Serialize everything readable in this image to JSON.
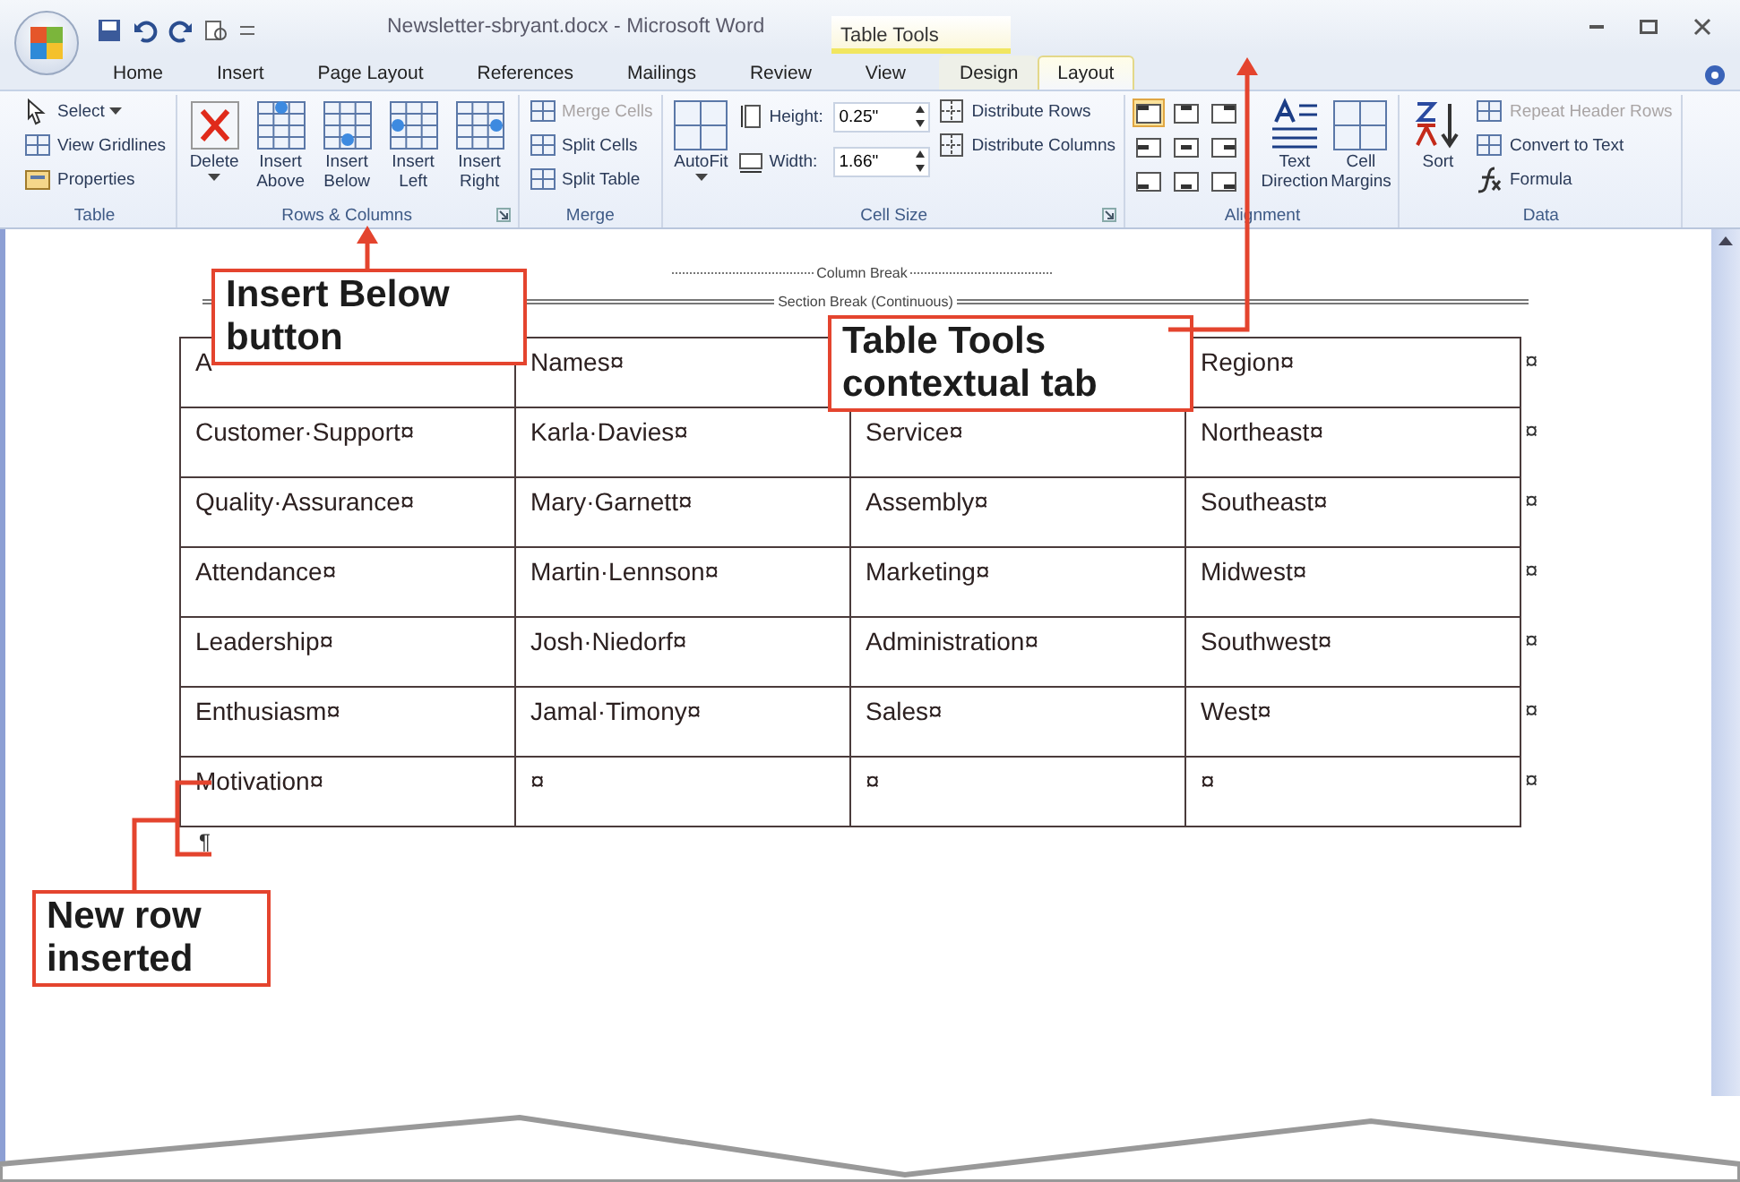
{
  "window": {
    "title": "Newsletter-sbryant.docx - Microsoft Word",
    "context_tab_label": "Table Tools"
  },
  "tabs": [
    {
      "label": "Home",
      "selected": false,
      "contextual": false
    },
    {
      "label": "Insert",
      "selected": false,
      "contextual": false
    },
    {
      "label": "Page Layout",
      "selected": false,
      "contextual": false
    },
    {
      "label": "References",
      "selected": false,
      "contextual": false
    },
    {
      "label": "Mailings",
      "selected": false,
      "contextual": false
    },
    {
      "label": "Review",
      "selected": false,
      "contextual": false
    },
    {
      "label": "View",
      "selected": false,
      "contextual": false
    },
    {
      "label": "Design",
      "selected": false,
      "contextual": true
    },
    {
      "label": "Layout",
      "selected": true,
      "contextual": true
    }
  ],
  "ribbon": [
    {
      "label": "Table",
      "launcher": false,
      "items": [
        {
          "kind": "small",
          "label": "Select",
          "dropdown": true,
          "disabled": false
        },
        {
          "kind": "small",
          "label": "View Gridlines",
          "dropdown": false,
          "disabled": false
        },
        {
          "kind": "small",
          "label": "Properties",
          "dropdown": false,
          "disabled": false
        }
      ]
    },
    {
      "label": "Rows & Columns",
      "launcher": true,
      "items": [
        {
          "kind": "large",
          "label": "Delete",
          "dropdown": true,
          "disabled": false
        },
        {
          "kind": "large",
          "label": "Insert Above",
          "dropdown": false,
          "disabled": false
        },
        {
          "kind": "large",
          "label": "Insert Below",
          "dropdown": false,
          "disabled": false
        },
        {
          "kind": "large",
          "label": "Insert Left",
          "dropdown": false,
          "disabled": false
        },
        {
          "kind": "large",
          "label": "Insert Right",
          "dropdown": false,
          "disabled": false
        }
      ]
    },
    {
      "label": "Merge",
      "launcher": false,
      "items": [
        {
          "kind": "small",
          "label": "Merge Cells",
          "dropdown": false,
          "disabled": true
        },
        {
          "kind": "small",
          "label": "Split Cells",
          "dropdown": false,
          "disabled": false
        },
        {
          "kind": "small",
          "label": "Split Table",
          "dropdown": false,
          "disabled": false
        }
      ]
    },
    {
      "label": "Cell Size",
      "launcher": true,
      "items": [
        {
          "kind": "large",
          "label": "AutoFit",
          "dropdown": true,
          "disabled": false
        },
        {
          "kind": "spin",
          "label": "Height:",
          "value": "0.25\""
        },
        {
          "kind": "spin",
          "label": "Width:",
          "value": "1.66\""
        },
        {
          "kind": "small",
          "label": "Distribute Rows",
          "dropdown": false,
          "disabled": false
        },
        {
          "kind": "small",
          "label": "Distribute Columns",
          "dropdown": false,
          "disabled": false
        }
      ]
    },
    {
      "label": "Alignment",
      "launcher": false,
      "items": [
        {
          "kind": "align_grid",
          "cells": [
            {
              "selected": true
            },
            {
              "selected": false
            },
            {
              "selected": false
            },
            {
              "selected": false
            },
            {
              "selected": false
            },
            {
              "selected": false
            },
            {
              "selected": false
            },
            {
              "selected": false
            },
            {
              "selected": false
            }
          ]
        },
        {
          "kind": "large",
          "label": "Text Direction",
          "dropdown": false,
          "disabled": false
        },
        {
          "kind": "large",
          "label": "Cell Margins",
          "dropdown": false,
          "disabled": false
        }
      ]
    },
    {
      "label": "Data",
      "launcher": false,
      "items": [
        {
          "kind": "large",
          "label": "Sort",
          "dropdown": false,
          "disabled": false
        },
        {
          "kind": "small",
          "label": "Repeat Header Rows",
          "dropdown": false,
          "disabled": true
        },
        {
          "kind": "small",
          "label": "Convert to Text",
          "dropdown": false,
          "disabled": false
        },
        {
          "kind": "small",
          "label": "Formula",
          "dropdown": false,
          "disabled": false
        }
      ]
    }
  ],
  "document": {
    "column_break": "Column Break",
    "section_break": "Section Break (Continuous)",
    "end_mark": "¶",
    "table": {
      "rows": [
        {
          "cells": [
            "A",
            "Names¤",
            null,
            "Region¤"
          ],
          "end_mark": "¤"
        },
        {
          "cells": [
            "Customer·Support¤",
            "Karla·Davies¤",
            "Service¤",
            "Northeast¤"
          ],
          "end_mark": "¤"
        },
        {
          "cells": [
            "Quality·Assurance¤",
            "Mary·Garnett¤",
            "Assembly¤",
            "Southeast¤"
          ],
          "end_mark": "¤"
        },
        {
          "cells": [
            "Attendance¤",
            "Martin·Lennson¤",
            "Marketing¤",
            "Midwest¤"
          ],
          "end_mark": "¤"
        },
        {
          "cells": [
            "Leadership¤",
            "Josh·Niedorf¤",
            "Administration¤",
            "Southwest¤"
          ],
          "end_mark": "¤"
        },
        {
          "cells": [
            "Enthusiasm¤",
            "Jamal·Timony¤",
            "Sales¤",
            "West¤"
          ],
          "end_mark": "¤"
        },
        {
          "cells": [
            "Motivation¤",
            "¤",
            "¤",
            "¤"
          ],
          "end_mark": "¤"
        }
      ]
    }
  },
  "callouts": [
    {
      "text": "Insert Below button"
    },
    {
      "text": "Table Tools contextual tab"
    },
    {
      "text": "New row inserted"
    }
  ]
}
